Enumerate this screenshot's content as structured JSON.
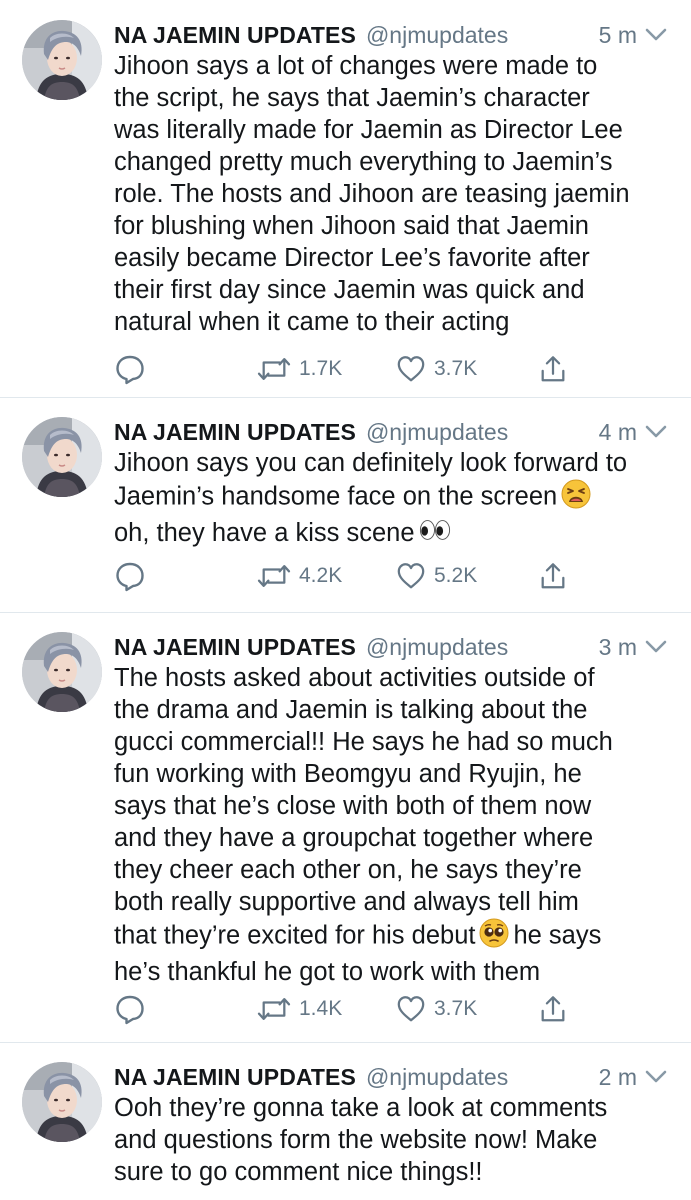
{
  "tweets": [
    {
      "display_name": "NA JAEMIN UPDATES",
      "handle": "@njmupdates",
      "time": "5 m",
      "lines": [
        "Jihoon says a lot of changes were made to",
        "the script, he says that Jaemin’s character",
        "was literally made for Jaemin as Director Lee",
        "changed pretty much everything to Jaemin’s",
        "role. The hosts and Jihoon are teasing jaemin",
        "for blushing when Jihoon said that Jaemin",
        "easily became Director Lee’s favorite after",
        "their first day since Jaemin was quick and",
        "natural when it came to their acting"
      ],
      "retweets": "1.7K",
      "likes": "3.7K"
    },
    {
      "display_name": "NA JAEMIN UPDATES",
      "handle": "@njmupdates",
      "time": "4 m",
      "lines": [
        "Jihoon says you can definitely look forward to",
        "Jaemin’s handsome face on the screen",
        "oh, they have a kiss scene"
      ],
      "retweets": "4.2K",
      "likes": "5.2K"
    },
    {
      "display_name": "NA JAEMIN UPDATES",
      "handle": "@njmupdates",
      "time": "3 m",
      "lines": [
        "The hosts asked about activities outside of",
        "the drama and Jaemin is talking about the",
        "gucci commercial!! He says he had so much",
        "fun working with Beomgyu and Ryujin, he",
        "says that he’s close with both of them now",
        "and they have a groupchat together where",
        "they cheer each other on, he says they’re",
        "both really supportive and always tell him",
        "that they’re excited for his debut",
        "he says",
        "he’s thankful he got to work with them"
      ],
      "retweets": "1.4K",
      "likes": "3.7K"
    },
    {
      "display_name": "NA JAEMIN UPDATES",
      "handle": "@njmupdates",
      "time": "2 m",
      "lines": [
        "Ooh they’re gonna take a look at comments",
        "and questions form the website now! Make",
        "sure to go comment nice things!!"
      ]
    }
  ],
  "icons": {
    "reply": "reply-icon",
    "retweet": "retweet-icon",
    "like": "heart-icon",
    "share": "share-icon",
    "caret": "chevron-down-icon",
    "weary_emoji": "weary-face-emoji",
    "eyes_emoji": "eyes-emoji",
    "pleading_emoji": "pleading-face-emoji"
  },
  "colors": {
    "text": "#14171a",
    "secondary": "#657786",
    "divider": "#e1e8ed"
  }
}
